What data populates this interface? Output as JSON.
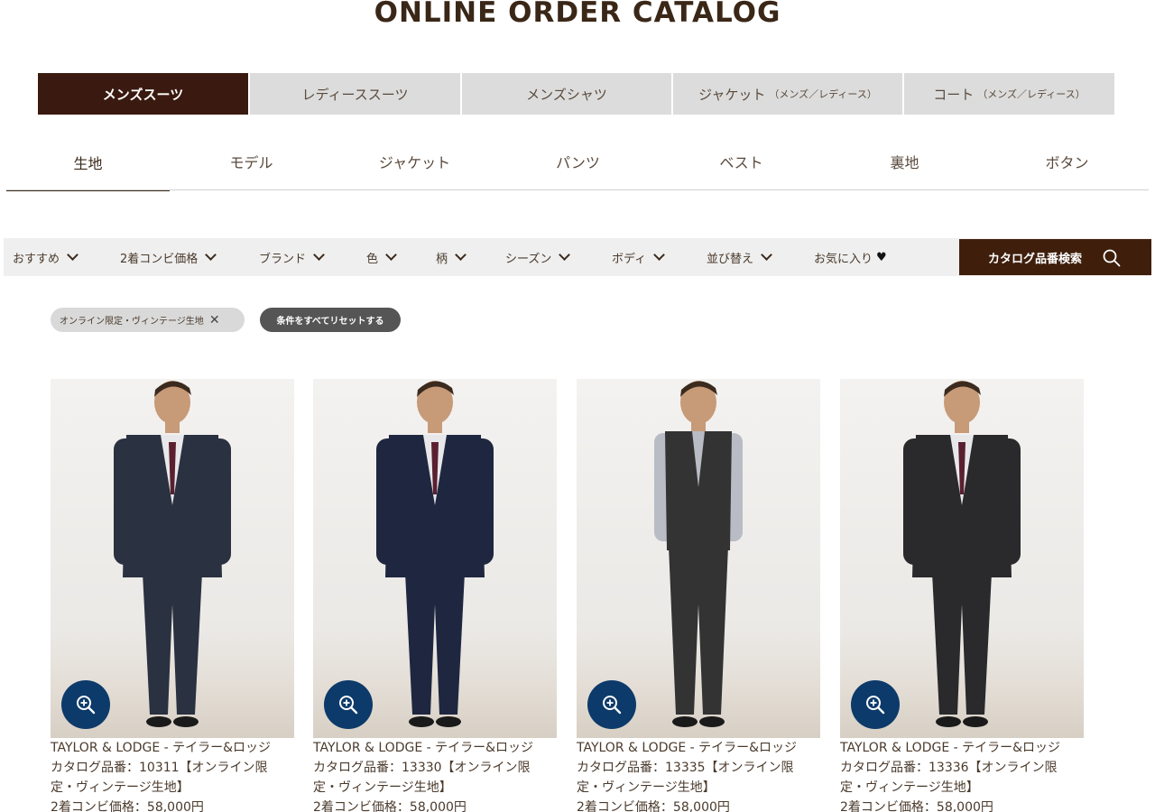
{
  "page_title": "ONLINE ORDER CATALOG",
  "category_tabs": [
    {
      "label": "メンズスーツ",
      "sub": ""
    },
    {
      "label": "レディーススーツ",
      "sub": ""
    },
    {
      "label": "メンズシャツ",
      "sub": ""
    },
    {
      "label": "ジャケット",
      "sub": "（メンズ／レディース）"
    },
    {
      "label": "コート",
      "sub": "（メンズ／レディース）"
    }
  ],
  "sub_tabs": [
    "生地",
    "モデル",
    "ジャケット",
    "パンツ",
    "ベスト",
    "裏地",
    "ボタン"
  ],
  "filters": [
    "おすすめ",
    "2着コンビ価格",
    "ブランド",
    "色",
    "柄",
    "シーズン",
    "ボディ",
    "並び替え",
    "お気に入り"
  ],
  "catalog_search_label": "カタログ品番検索",
  "chips": {
    "active_filter": "オンライン限定・ヴィンテージ生地",
    "reset": "条件をすべてリセットする"
  },
  "products": [
    {
      "brand": "TAYLOR & LODGE - テイラー&ロッジ",
      "catalog_line1": "カタログ品番：10311【オンライン限",
      "catalog_line2": "定・ヴィンテージ生地】",
      "price": "2着コンビ価格：58,000円",
      "suit_color": "#2a3140",
      "style": "double"
    },
    {
      "brand": "TAYLOR & LODGE - テイラー&ロッジ",
      "catalog_line1": "カタログ品番：13330【オンライン限",
      "catalog_line2": "定・ヴィンテージ生地】",
      "price": "2着コンビ価格：58,000円",
      "suit_color": "#1f2740",
      "style": "double"
    },
    {
      "brand": "TAYLOR & LODGE - テイラー&ロッジ",
      "catalog_line1": "カタログ品番：13335【オンライン限",
      "catalog_line2": "定・ヴィンテージ生地】",
      "price": "2着コンビ価格：58,000円",
      "suit_color": "#333333",
      "style": "vest"
    },
    {
      "brand": "TAYLOR & LODGE - テイラー&ロッジ",
      "catalog_line1": "カタログ品番：13336【オンライン限",
      "catalog_line2": "定・ヴィンテージ生地】",
      "price": "2着コンビ価格：58,000円",
      "suit_color": "#2a2a2c",
      "style": "double"
    }
  ],
  "colors": {
    "brand_dark": "#3a1a10",
    "search_button": "#3f1f0c",
    "zoom_button": "#0c3a6a",
    "tab_inactive": "#dcdcdc",
    "filter_bar": "#efefef"
  },
  "icons": [
    "chevron-down-icon",
    "heart-icon",
    "search-icon",
    "close-icon",
    "zoom-in-icon"
  ]
}
